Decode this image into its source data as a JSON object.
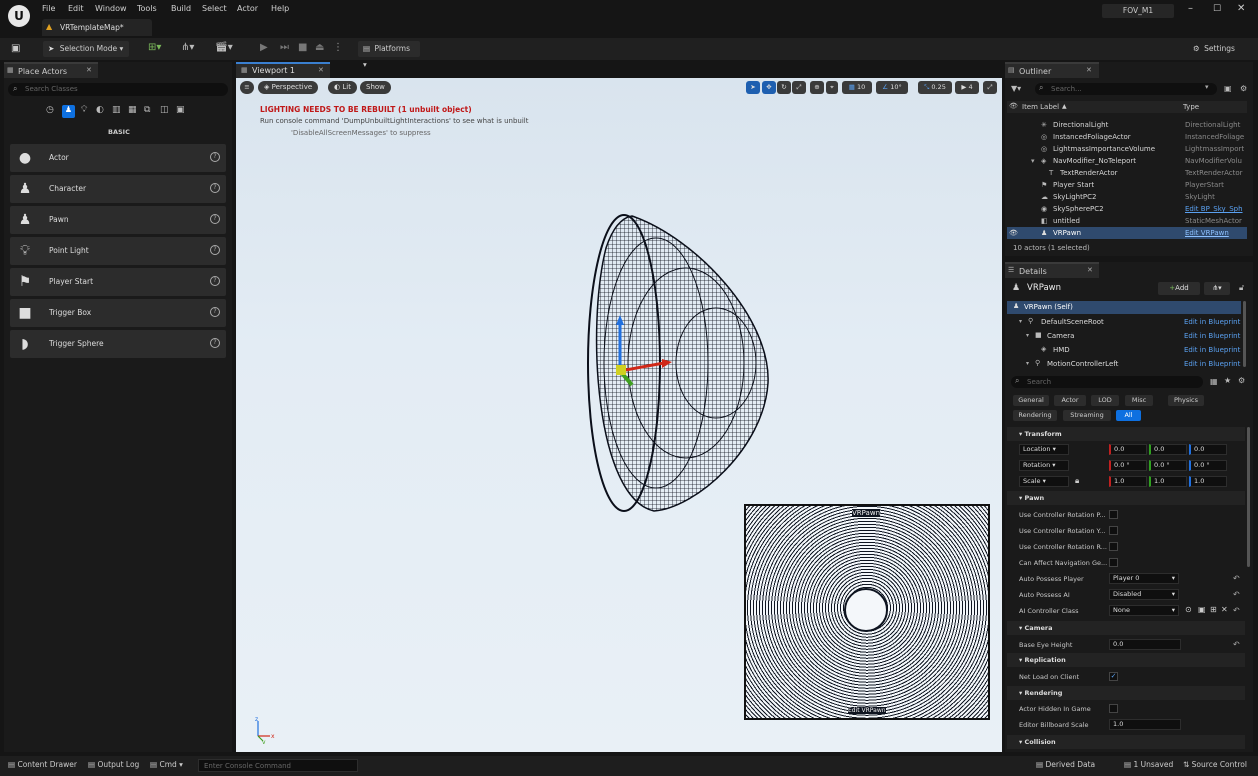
{
  "titlebar": {
    "map_tab": "VRTemplateMap*",
    "project": "FOV_M1",
    "menu": [
      "File",
      "Edit",
      "Window",
      "Tools",
      "Build",
      "Select",
      "Actor",
      "Help"
    ],
    "window_controls": [
      "minimize-icon",
      "maximize-icon",
      "close-icon"
    ]
  },
  "toolbar": {
    "selection_mode": "Selection Mode",
    "platforms": "Platforms",
    "settings": "Settings"
  },
  "place_actors": {
    "tab": "Place Actors",
    "search_placeholder": "Search Classes",
    "section": "BASIC",
    "items": [
      "Actor",
      "Character",
      "Pawn",
      "Point Light",
      "Player Start",
      "Trigger Box",
      "Trigger Sphere"
    ]
  },
  "viewport": {
    "tab": "Viewport 1",
    "perspective": "Perspective",
    "lit": "Lit",
    "show": "Show",
    "warning": "LIGHTING NEEDS TO BE REBUILT (1 unbuilt object)",
    "info1": "Run console command 'DumpUnbuiltLightInteractions' to see what is unbuilt",
    "info2": "'DisableAllScreenMessages' to suppress",
    "grid": "10",
    "rotate": "10°",
    "scale": "0.25",
    "cam_speed": "4",
    "pip_label": "VRPawn",
    "pip_caption": "Edit VRPawn"
  },
  "outliner": {
    "tab": "Outliner",
    "search_placeholder": "Search...",
    "col_label": "Item Label",
    "col_type": "Type",
    "rows": [
      {
        "name": "DirectionalLight",
        "type": "DirectionalLight"
      },
      {
        "name": "InstancedFoliageActor",
        "type": "InstancedFoliage"
      },
      {
        "name": "LightmassImportanceVolume",
        "type": "LightmassImport"
      },
      {
        "name": "NavModifier_NoTeleport",
        "type": "NavModifierVolu"
      },
      {
        "name": "TextRenderActor",
        "type": "TextRenderActor"
      },
      {
        "name": "Player Start",
        "type": "PlayerStart"
      },
      {
        "name": "SkyLightPC2",
        "type": "SkyLight"
      },
      {
        "name": "SkySpherePC2",
        "type": "Edit BP_Sky_Sph"
      },
      {
        "name": "untitled",
        "type": "StaticMeshActor"
      },
      {
        "name": "VRPawn",
        "type": "Edit VRPawn"
      }
    ],
    "count": "10 actors (1 selected)"
  },
  "details": {
    "tab": "Details",
    "actor": "VRPawn",
    "add": "Add",
    "components": [
      {
        "name": "VRPawn (Self)",
        "link": ""
      },
      {
        "name": "DefaultSceneRoot",
        "link": "Edit in Blueprint"
      },
      {
        "name": "Camera",
        "link": "Edit in Blueprint"
      },
      {
        "name": "HMD",
        "link": "Edit in Blueprint"
      },
      {
        "name": "MotionControllerLeft",
        "link": "Edit in Blueprint"
      }
    ],
    "search_placeholder": "Search",
    "filters": [
      "General",
      "Actor",
      "LOD",
      "Misc",
      "Physics",
      "Rendering",
      "Streaming",
      "All"
    ],
    "transform": {
      "title": "Transform",
      "location": "Location",
      "rotation": "Rotation",
      "scale": "Scale",
      "loc": [
        "0.0",
        "0.0",
        "0.0"
      ],
      "rot": [
        "0.0 °",
        "0.0 °",
        "0.0 °"
      ],
      "scl": [
        "1.0",
        "1.0",
        "1.0"
      ]
    },
    "pawn": {
      "title": "Pawn",
      "p1": "Use Controller Rotation P...",
      "p2": "Use Controller Rotation Y...",
      "p3": "Use Controller Rotation R...",
      "p4": "Can Affect Navigation Ge...",
      "p5": "Auto Possess Player",
      "p5v": "Player 0",
      "p6": "Auto Possess AI",
      "p6v": "Disabled",
      "p7": "AI Controller Class",
      "p7v": "None"
    },
    "camera": {
      "title": "Camera",
      "p1": "Base Eye Height",
      "v1": "0.0"
    },
    "replication": {
      "title": "Replication",
      "p1": "Net Load on Client"
    },
    "rendering": {
      "title": "Rendering",
      "p1": "Actor Hidden In Game",
      "p2": "Editor Billboard Scale",
      "v2": "1.0"
    },
    "collision": {
      "title": "Collision"
    }
  },
  "statusbar": {
    "content_drawer": "Content Drawer",
    "output_log": "Output Log",
    "cmd": "Cmd",
    "console_placeholder": "Enter Console Command",
    "derived": "Derived Data",
    "unsaved": "1 Unsaved",
    "source": "Source Control"
  },
  "colors": {
    "accent": "#0e70e0",
    "warning": "#c01818",
    "bg": "#151515"
  }
}
